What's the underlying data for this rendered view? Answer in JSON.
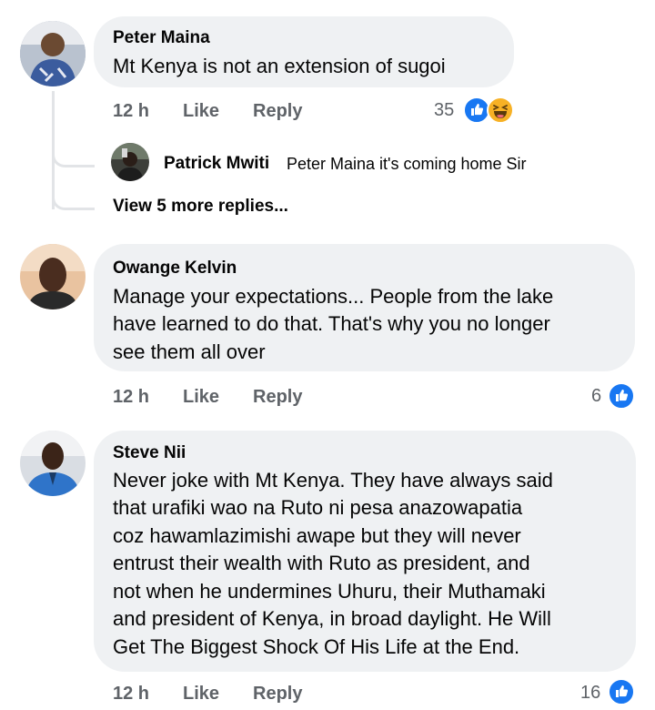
{
  "comments": [
    {
      "author": "Peter Maina",
      "text": "Mt Kenya is not an extension of sugoi",
      "time": "12 h",
      "like_label": "Like",
      "reply_label": "Reply",
      "reaction_count": "35",
      "reactions": [
        "like-icon",
        "haha-icon"
      ],
      "replies": [
        {
          "author": "Patrick Mwiti",
          "text": "Peter Maina it's coming home Sir"
        }
      ],
      "view_more_label": "View 5 more replies..."
    },
    {
      "author": "Owange Kelvin",
      "text_lines": [
        "Manage your expectations... People from the lake",
        "have learned to do that. That's why you no longer",
        "see them all over"
      ],
      "time": "12 h",
      "like_label": "Like",
      "reply_label": "Reply",
      "reaction_count": "6",
      "reactions": [
        "like-icon"
      ]
    },
    {
      "author": "Steve Nii",
      "text_lines": [
        "Never joke with Mt Kenya. They have always said",
        "that urafiki wao na Ruto ni pesa anazowapatia",
        "coz hawamlazimishi awape but they will never",
        "entrust their wealth with Ruto as president, and",
        "not when he undermines Uhuru, their Muthamaki",
        "and president of Kenya, in broad daylight.  He Will",
        "Get The Biggest Shock Of His Life at the End."
      ],
      "time": "12 h",
      "like_label": "Like",
      "reply_label": "Reply",
      "reaction_count": "16",
      "reactions": [
        "like-icon"
      ]
    }
  ],
  "colors": {
    "bubble": "#eff1f3",
    "meta_text": "#5f6368",
    "like_blue": "#1877f2",
    "haha_yellow": "#f7b125"
  }
}
